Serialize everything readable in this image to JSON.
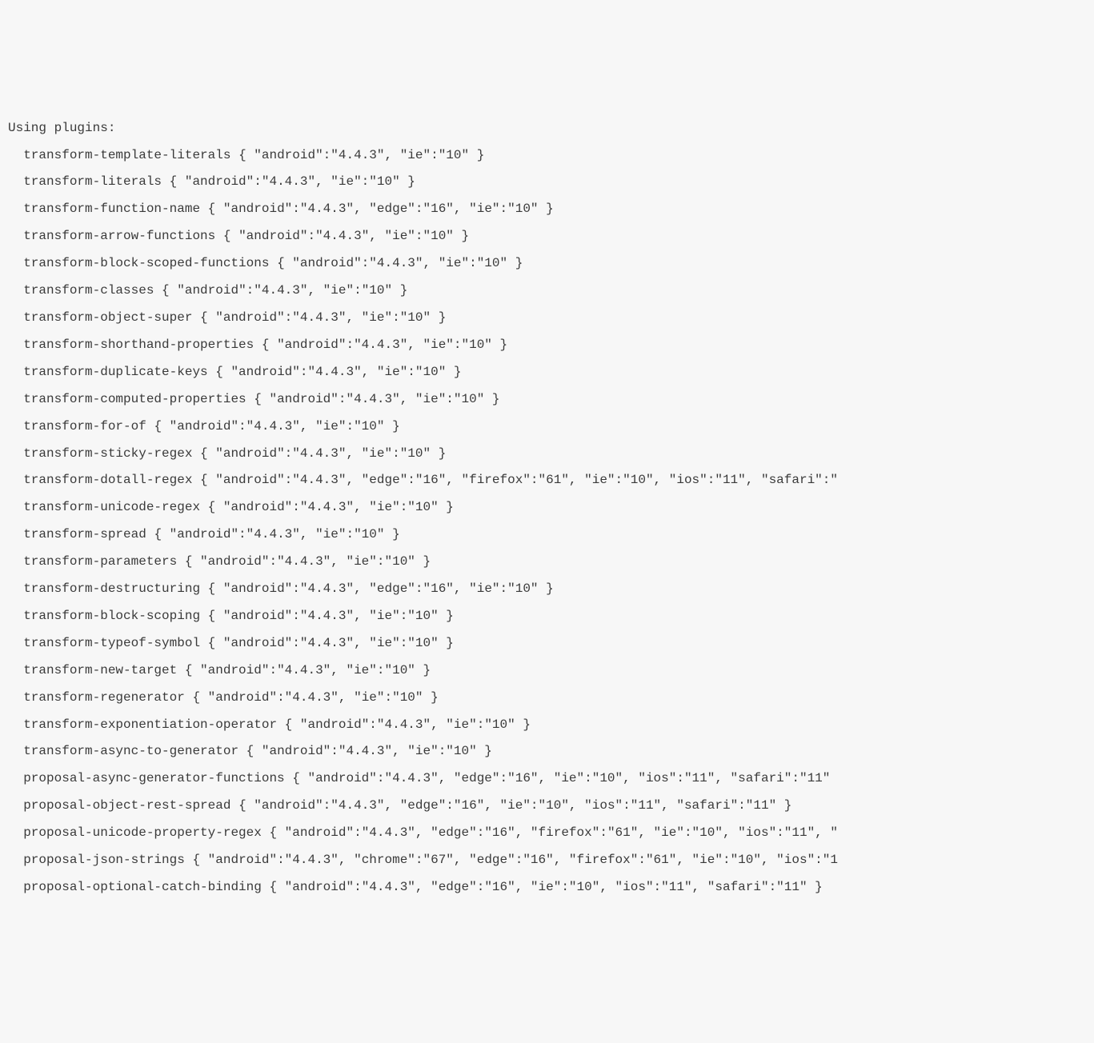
{
  "header": "Using plugins:",
  "plugins": [
    {
      "name": "transform-template-literals",
      "targets": "{ \"android\":\"4.4.3\", \"ie\":\"10\" }"
    },
    {
      "name": "transform-literals",
      "targets": "{ \"android\":\"4.4.3\", \"ie\":\"10\" }"
    },
    {
      "name": "transform-function-name",
      "targets": "{ \"android\":\"4.4.3\", \"edge\":\"16\", \"ie\":\"10\" }"
    },
    {
      "name": "transform-arrow-functions",
      "targets": "{ \"android\":\"4.4.3\", \"ie\":\"10\" }"
    },
    {
      "name": "transform-block-scoped-functions",
      "targets": "{ \"android\":\"4.4.3\", \"ie\":\"10\" }"
    },
    {
      "name": "transform-classes",
      "targets": "{ \"android\":\"4.4.3\", \"ie\":\"10\" }"
    },
    {
      "name": "transform-object-super",
      "targets": "{ \"android\":\"4.4.3\", \"ie\":\"10\" }"
    },
    {
      "name": "transform-shorthand-properties",
      "targets": "{ \"android\":\"4.4.3\", \"ie\":\"10\" }"
    },
    {
      "name": "transform-duplicate-keys",
      "targets": "{ \"android\":\"4.4.3\", \"ie\":\"10\" }"
    },
    {
      "name": "transform-computed-properties",
      "targets": "{ \"android\":\"4.4.3\", \"ie\":\"10\" }"
    },
    {
      "name": "transform-for-of",
      "targets": "{ \"android\":\"4.4.3\", \"ie\":\"10\" }"
    },
    {
      "name": "transform-sticky-regex",
      "targets": "{ \"android\":\"4.4.3\", \"ie\":\"10\" }"
    },
    {
      "name": "transform-dotall-regex",
      "targets": "{ \"android\":\"4.4.3\", \"edge\":\"16\", \"firefox\":\"61\", \"ie\":\"10\", \"ios\":\"11\", \"safari\":\""
    },
    {
      "name": "transform-unicode-regex",
      "targets": "{ \"android\":\"4.4.3\", \"ie\":\"10\" }"
    },
    {
      "name": "transform-spread",
      "targets": "{ \"android\":\"4.4.3\", \"ie\":\"10\" }"
    },
    {
      "name": "transform-parameters",
      "targets": "{ \"android\":\"4.4.3\", \"ie\":\"10\" }"
    },
    {
      "name": "transform-destructuring",
      "targets": "{ \"android\":\"4.4.3\", \"edge\":\"16\", \"ie\":\"10\" }"
    },
    {
      "name": "transform-block-scoping",
      "targets": "{ \"android\":\"4.4.3\", \"ie\":\"10\" }"
    },
    {
      "name": "transform-typeof-symbol",
      "targets": "{ \"android\":\"4.4.3\", \"ie\":\"10\" }"
    },
    {
      "name": "transform-new-target",
      "targets": "{ \"android\":\"4.4.3\", \"ie\":\"10\" }"
    },
    {
      "name": "transform-regenerator",
      "targets": "{ \"android\":\"4.4.3\", \"ie\":\"10\" }"
    },
    {
      "name": "transform-exponentiation-operator",
      "targets": "{ \"android\":\"4.4.3\", \"ie\":\"10\" }"
    },
    {
      "name": "transform-async-to-generator",
      "targets": "{ \"android\":\"4.4.3\", \"ie\":\"10\" }"
    },
    {
      "name": "proposal-async-generator-functions",
      "targets": "{ \"android\":\"4.4.3\", \"edge\":\"16\", \"ie\":\"10\", \"ios\":\"11\", \"safari\":\"11\""
    },
    {
      "name": "proposal-object-rest-spread",
      "targets": "{ \"android\":\"4.4.3\", \"edge\":\"16\", \"ie\":\"10\", \"ios\":\"11\", \"safari\":\"11\" }"
    },
    {
      "name": "proposal-unicode-property-regex",
      "targets": "{ \"android\":\"4.4.3\", \"edge\":\"16\", \"firefox\":\"61\", \"ie\":\"10\", \"ios\":\"11\", \""
    },
    {
      "name": "proposal-json-strings",
      "targets": "{ \"android\":\"4.4.3\", \"chrome\":\"67\", \"edge\":\"16\", \"firefox\":\"61\", \"ie\":\"10\", \"ios\":\"1"
    },
    {
      "name": "proposal-optional-catch-binding",
      "targets": "{ \"android\":\"4.4.3\", \"edge\":\"16\", \"ie\":\"10\", \"ios\":\"11\", \"safari\":\"11\" }"
    }
  ]
}
